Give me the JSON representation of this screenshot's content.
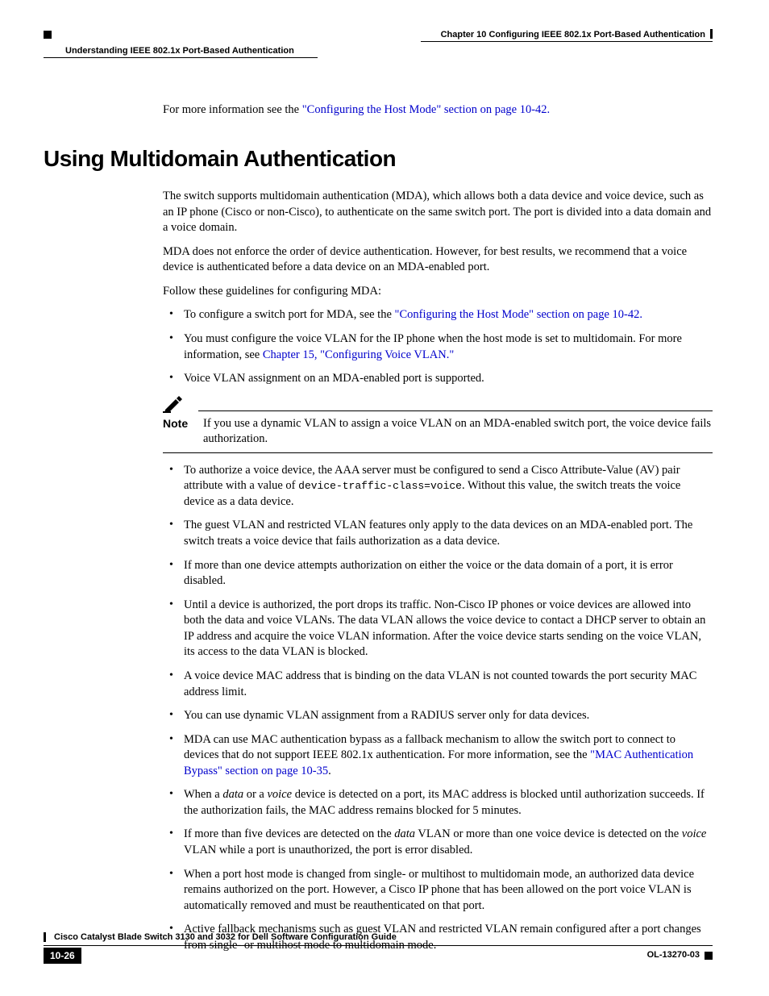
{
  "header": {
    "chapter": "Chapter 10    Configuring IEEE 802.1x Port-Based Authentication",
    "section": "Understanding IEEE 802.1x Port-Based Authentication"
  },
  "intro": {
    "prefix": "For more information see the ",
    "link": "\"Configuring the Host Mode\" section on page 10-42."
  },
  "heading": "Using Multidomain Authentication",
  "para1": "The switch supports multidomain authentication (MDA), which allows both a data device and voice device, such as an IP phone (Cisco or non-Cisco), to authenticate on the same switch port. The port is divided into a data domain and a voice domain.",
  "para2": "MDA does not enforce the order of device authentication. However, for best results, we recommend that a voice device is authenticated before a data device on an MDA-enabled port.",
  "para3": "Follow these guidelines for configuring MDA:",
  "bul1": {
    "prefix": "To configure a switch port for MDA, see the ",
    "link": "\"Configuring the Host Mode\" section on page 10-42."
  },
  "bul2": {
    "prefix": "You must configure the voice VLAN for the IP phone when the host mode is set to multidomain. For more information, see ",
    "link": "Chapter 15, \"Configuring Voice VLAN.\""
  },
  "bul3": "Voice VLAN assignment on an MDA-enabled port is supported.",
  "note": {
    "label": "Note",
    "text": "If you use a dynamic VLAN to assign a voice VLAN on an MDA-enabled switch port, the voice device fails authorization."
  },
  "bul4_a": "To authorize a voice device, the AAA server must be configured to send a Cisco Attribute-Value (AV) pair attribute with a value of ",
  "bul4_code": "device-traffic-class=voice",
  "bul4_b": ". Without this value, the switch treats the voice device as a data device.",
  "bul5": "The guest VLAN and restricted VLAN features only apply to the data devices on an MDA-enabled port. The switch treats a voice device that fails authorization as a data device.",
  "bul6": "If more than one device attempts authorization on either the voice or the data domain of a port, it is error disabled.",
  "bul7": "Until a device is authorized, the port drops its traffic. Non-Cisco IP phones or voice devices are allowed into both the data and voice VLANs. The data VLAN allows the voice device to contact a DHCP server to obtain an IP address and acquire the voice VLAN information. After the voice device starts sending on the voice VLAN, its access to the data VLAN is blocked.",
  "bul8": "A voice device MAC address that is binding on the data VLAN is not counted towards the port security MAC address limit.",
  "bul9": "You can use dynamic VLAN assignment from a RADIUS server only for data devices.",
  "bul10_a": "MDA can use MAC authentication bypass as a fallback mechanism to allow the switch port to connect to devices that do not support IEEE 802.1x authentication. For more information, see the ",
  "bul10_link": "\"MAC Authentication Bypass\" section on page 10-35",
  "bul10_b": ".",
  "bul11_a": "When a ",
  "bul11_i1": "data",
  "bul11_b": " or a ",
  "bul11_i2": "voice",
  "bul11_c": " device is detected on a port, its MAC address is blocked until authorization succeeds. If the authorization fails, the MAC address remains blocked for 5 minutes.",
  "bul12_a": "If more than five devices are detected on the ",
  "bul12_i1": "data",
  "bul12_b": " VLAN or more than one voice device is detected on the ",
  "bul12_i2": "voice",
  "bul12_c": " VLAN while a port is unauthorized, the port is error disabled.",
  "bul13": "When a port host mode is changed from single- or multihost to multidomain mode, an authorized data device remains authorized on the port. However, a Cisco IP phone that has been allowed on the port voice VLAN is automatically removed and must be reauthenticated on that port.",
  "bul14": "Active fallback mechanisms such as guest VLAN and restricted VLAN remain configured after a port changes from single- or multihost mode to multidomain mode.",
  "footer": {
    "guide": "Cisco Catalyst Blade Switch 3130 and 3032 for Dell Software Configuration Guide",
    "page": "10-26",
    "docid": "OL-13270-03"
  }
}
